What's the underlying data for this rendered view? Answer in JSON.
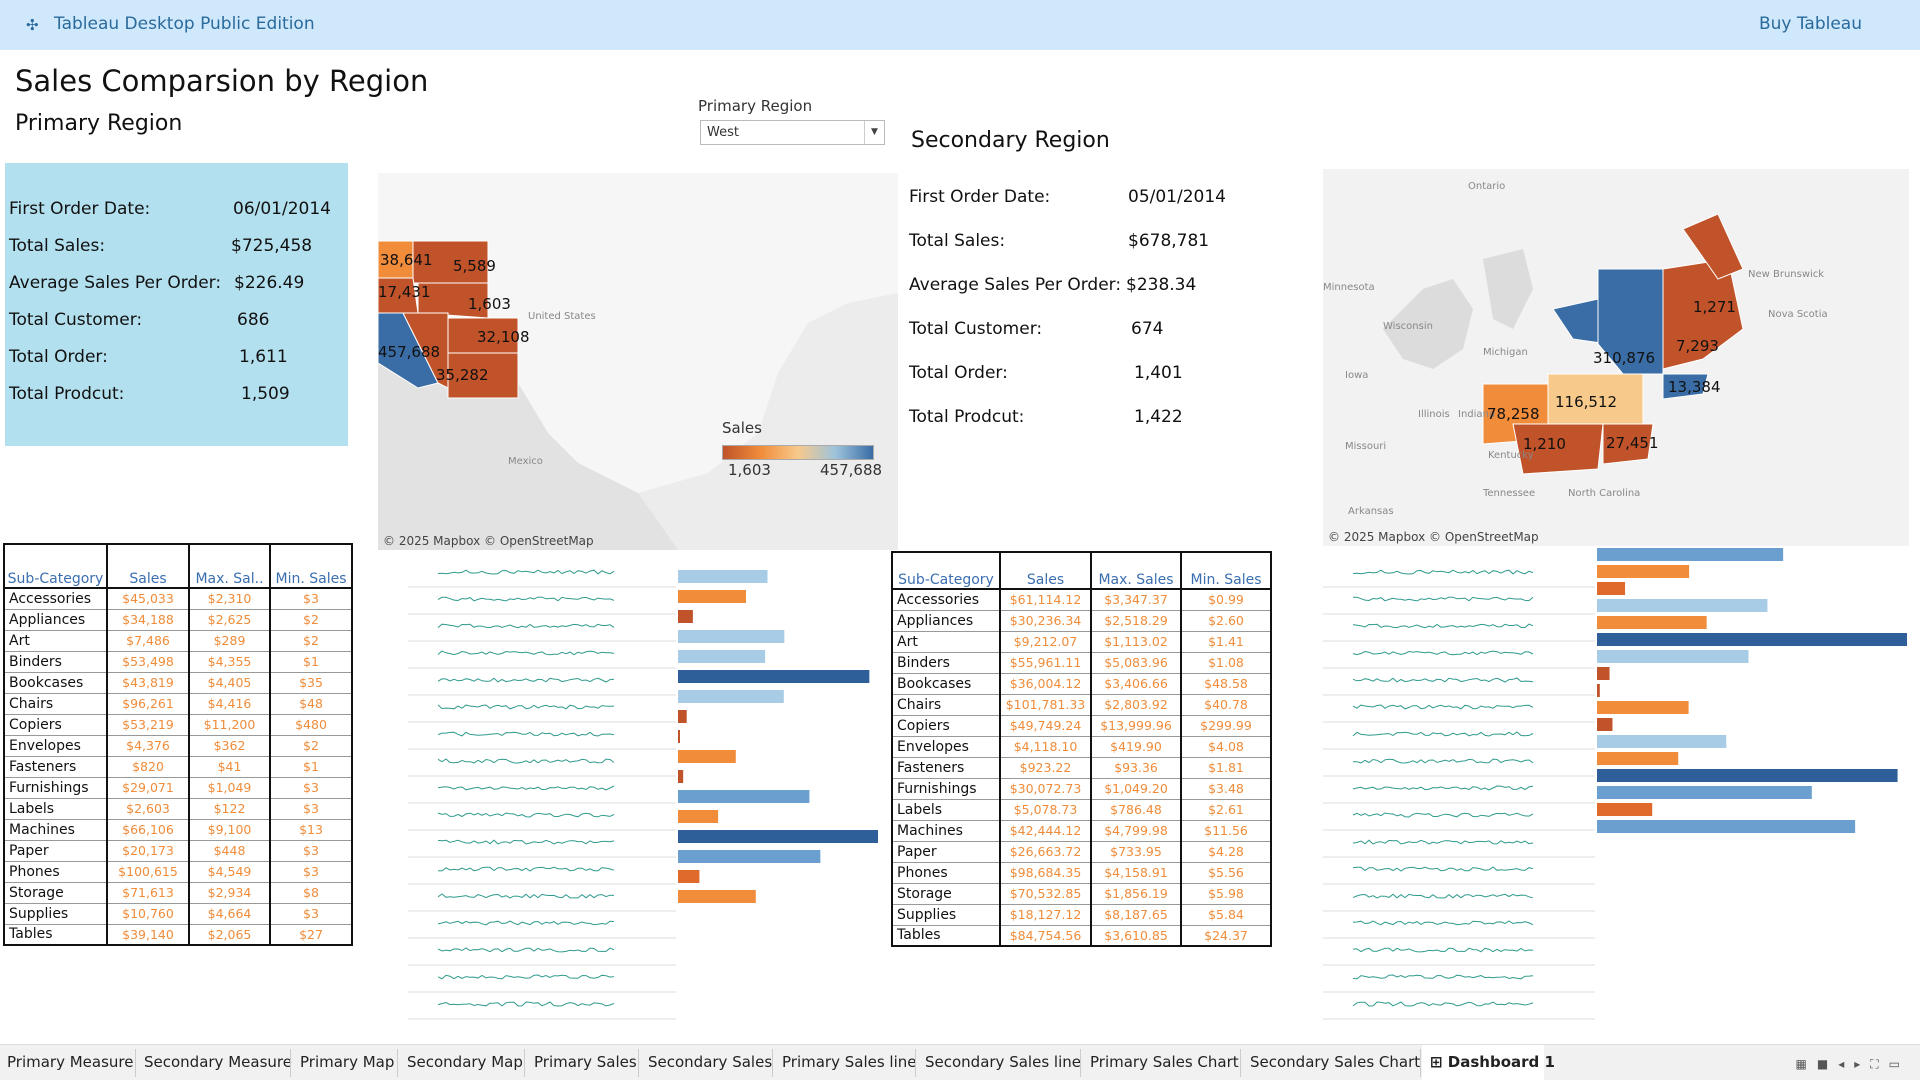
{
  "topbar": {
    "title": "Tableau Desktop Public Edition",
    "buy": "Buy Tableau",
    "logo_icon": "tableau-logo-icon"
  },
  "dashboard": {
    "title": "Sales Comparsion by Region",
    "primary_heading": "Primary Region",
    "secondary_heading": "Secondary Region",
    "filter": {
      "label": "Primary Region",
      "value": "West"
    }
  },
  "primary_kpis": [
    {
      "label": "First Order Date:",
      "value": "06/01/2014"
    },
    {
      "label": "Total Sales:",
      "value": "$725,458"
    },
    {
      "label": "Average Sales Per Order:",
      "value": "$226.49"
    },
    {
      "label": "Total Customer:",
      "value": "686"
    },
    {
      "label": "Total Order:",
      "value": "1,611"
    },
    {
      "label": "Total Prodcut:",
      "value": "1,509"
    }
  ],
  "secondary_kpis": [
    {
      "label": "First Order Date:",
      "value": "05/01/2014"
    },
    {
      "label": "Total Sales:",
      "value": "$678,781"
    },
    {
      "label": "Average Sales Per Order:",
      "value": "$238.34"
    },
    {
      "label": "Total Customer:",
      "value": "674"
    },
    {
      "label": "Total Order:",
      "value": "1,401"
    },
    {
      "label": "Total Prodcut:",
      "value": "1,422"
    }
  ],
  "primary_map": {
    "credit": "© 2025 Mapbox © OpenStreetMap",
    "places": [
      "United States",
      "Mexico"
    ],
    "values": [
      "38,641",
      "5,589",
      "17,431",
      "1,603",
      "32,108",
      "457,688",
      "35,282"
    ]
  },
  "secondary_map": {
    "credit": "© 2025 Mapbox © OpenStreetMap",
    "places": [
      "Ontario",
      "Minnesota",
      "Wisconsin",
      "Michigan",
      "Iowa",
      "Illinois",
      "Indiana",
      "Missouri",
      "Kentucky",
      "Tennessee",
      "Arkansas",
      "North Carolina",
      "New Brunswick",
      "Nova Scotia"
    ],
    "values": [
      "1,271",
      "7,293",
      "310,876",
      "13,384",
      "78,258",
      "116,512",
      "1,210",
      "27,451"
    ]
  },
  "legend": {
    "title": "Sales",
    "min": "1,603",
    "max": "457,688"
  },
  "table_headers": {
    "sub": "Sub-Category",
    "sales": "Sales",
    "max_short": "Max. Sal..",
    "max": "Max. Sales",
    "min": "Min. Sales"
  },
  "primary_table": [
    [
      "Accessories",
      "$45,033",
      "$2,310",
      "$3"
    ],
    [
      "Appliances",
      "$34,188",
      "$2,625",
      "$2"
    ],
    [
      "Art",
      "$7,486",
      "$289",
      "$2"
    ],
    [
      "Binders",
      "$53,498",
      "$4,355",
      "$1"
    ],
    [
      "Bookcases",
      "$43,819",
      "$4,405",
      "$35"
    ],
    [
      "Chairs",
      "$96,261",
      "$4,416",
      "$48"
    ],
    [
      "Copiers",
      "$53,219",
      "$11,200",
      "$480"
    ],
    [
      "Envelopes",
      "$4,376",
      "$362",
      "$2"
    ],
    [
      "Fasteners",
      "$820",
      "$41",
      "$1"
    ],
    [
      "Furnishings",
      "$29,071",
      "$1,049",
      "$3"
    ],
    [
      "Labels",
      "$2,603",
      "$122",
      "$3"
    ],
    [
      "Machines",
      "$66,106",
      "$9,100",
      "$13"
    ],
    [
      "Paper",
      "$20,173",
      "$448",
      "$3"
    ],
    [
      "Phones",
      "$100,615",
      "$4,549",
      "$3"
    ],
    [
      "Storage",
      "$71,613",
      "$2,934",
      "$8"
    ],
    [
      "Supplies",
      "$10,760",
      "$4,664",
      "$3"
    ],
    [
      "Tables",
      "$39,140",
      "$2,065",
      "$27"
    ]
  ],
  "secondary_table": [
    [
      "Accessories",
      "$61,114.12",
      "$3,347.37",
      "$0.99"
    ],
    [
      "Appliances",
      "$30,236.34",
      "$2,518.29",
      "$2.60"
    ],
    [
      "Art",
      "$9,212.07",
      "$1,113.02",
      "$1.41"
    ],
    [
      "Binders",
      "$55,961.11",
      "$5,083.96",
      "$1.08"
    ],
    [
      "Bookcases",
      "$36,004.12",
      "$3,406.66",
      "$48.58"
    ],
    [
      "Chairs",
      "$101,781.33",
      "$2,803.92",
      "$40.78"
    ],
    [
      "Copiers",
      "$49,749.24",
      "$13,999.96",
      "$299.99"
    ],
    [
      "Envelopes",
      "$4,118.10",
      "$419.90",
      "$4.08"
    ],
    [
      "Fasteners",
      "$923.22",
      "$93.36",
      "$1.81"
    ],
    [
      "Furnishings",
      "$30,072.73",
      "$1,049.20",
      "$3.48"
    ],
    [
      "Labels",
      "$5,078.73",
      "$786.48",
      "$2.61"
    ],
    [
      "Machines",
      "$42,444.12",
      "$4,799.98",
      "$11.56"
    ],
    [
      "Paper",
      "$26,663.72",
      "$733.95",
      "$4.28"
    ],
    [
      "Phones",
      "$98,684.35",
      "$4,158.91",
      "$5.56"
    ],
    [
      "Storage",
      "$70,532.85",
      "$1,856.19",
      "$5.98"
    ],
    [
      "Supplies",
      "$18,127.12",
      "$8,187.65",
      "$5.84"
    ],
    [
      "Tables",
      "$84,754.56",
      "$3,610.85",
      "$24.37"
    ]
  ],
  "colors": {
    "topbar": "#cfe8fb",
    "kpi_box": "#b3e0ee",
    "header_text": "#3b6fb0",
    "value_text": "#f08c3a",
    "spark": "#2f9a8c"
  },
  "tabs": [
    "Primary Measure",
    "Secondary Measure",
    "Primary Map",
    "Secondary Map",
    "Primary Sales",
    "Secondary Sales",
    "Primary Sales line",
    "Secondary Sales line",
    "Primary Sales Chart",
    "Secondary Sales Chart",
    "Dashboard 1"
  ],
  "active_tab": "Dashboard 1"
}
